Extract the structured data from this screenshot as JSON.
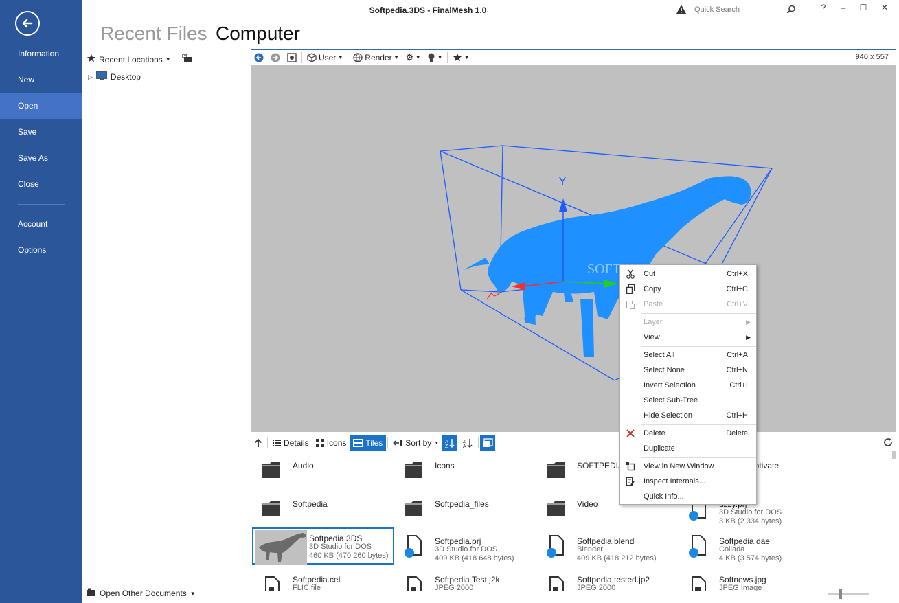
{
  "window": {
    "title": "Softpedia.3DS - FinalMesh 1.0",
    "search_placeholder": "Quick Search",
    "controls": [
      "?",
      "–",
      "☐",
      "✕"
    ]
  },
  "sidebar": {
    "items": [
      {
        "label": "Information"
      },
      {
        "label": "New"
      },
      {
        "label": "Open",
        "active": true
      },
      {
        "label": "Save"
      },
      {
        "label": "Save As"
      },
      {
        "label": "Close"
      }
    ],
    "bottom_items": [
      {
        "label": "Account"
      },
      {
        "label": "Options"
      }
    ]
  },
  "headings": {
    "recent": "Recent Files",
    "computer": "Computer"
  },
  "left_panel": {
    "recent_locations": "Recent Locations",
    "tree_desktop": "Desktop",
    "open_other": "Open Other Documents"
  },
  "viewer": {
    "user_label": "User",
    "render_label": "Render",
    "size_label": "940 x 557",
    "axis_label": "Y",
    "watermark": "SOFTPEDIA"
  },
  "files_toolbar": {
    "details": "Details",
    "icons": "Icons",
    "tiles": "Tiles",
    "sort_by": "Sort by"
  },
  "files": [
    {
      "name": "Audio",
      "kind": "folder"
    },
    {
      "name": "Icons",
      "kind": "folder"
    },
    {
      "name": "SOFTPEDIA 1",
      "kind": "folder"
    },
    {
      "name": "aptivate",
      "kind": "folder"
    },
    {
      "name": "Softpedia",
      "kind": "folder"
    },
    {
      "name": "Softpedia_files",
      "kind": "folder"
    },
    {
      "name": "Video",
      "kind": "folder"
    },
    {
      "name": "uzzy.prj",
      "type": "3D Studio for DOS",
      "size": "3 KB (2 334 bytes)",
      "kind": "file"
    },
    {
      "name": "Softpedia.3DS",
      "type": "3D Studio for DOS",
      "size": "460 KB (470 260 bytes)",
      "kind": "thumb"
    },
    {
      "name": "Softpedia.prj",
      "type": "3D Studio for DOS",
      "size": "409 KB (418 648 bytes)",
      "kind": "file"
    },
    {
      "name": "Softpedia.blend",
      "type": "Blender",
      "size": "409 KB (418 212 bytes)",
      "kind": "file"
    },
    {
      "name": "Softpedia.dae",
      "type": "Collada",
      "size": "4 KB (3 574 bytes)",
      "kind": "file"
    },
    {
      "name": "Softpedia.cel",
      "type": "FLIC file",
      "kind": "doc"
    },
    {
      "name": "Softpedia Test.j2k",
      "type": "JPEG 2000",
      "kind": "doc"
    },
    {
      "name": "Softpedia tested.jp2",
      "type": "JPEG 2000",
      "kind": "doc"
    },
    {
      "name": "Softnews.jpg",
      "type": "JPEG Image",
      "kind": "doc"
    }
  ],
  "context_menu": {
    "cut": {
      "label": "Cut",
      "shortcut": "Ctrl+X"
    },
    "copy": {
      "label": "Copy",
      "shortcut": "Ctrl+C"
    },
    "paste": {
      "label": "Paste",
      "shortcut": "Ctrl+V"
    },
    "layer": {
      "label": "Layer"
    },
    "view": {
      "label": "View"
    },
    "select_all": {
      "label": "Select All",
      "shortcut": "Ctrl+A"
    },
    "select_none": {
      "label": "Select None",
      "shortcut": "Ctrl+N"
    },
    "invert_selection": {
      "label": "Invert Selection",
      "shortcut": "Ctrl+I"
    },
    "select_subtree": {
      "label": "Select Sub-Tree"
    },
    "hide_selection": {
      "label": "Hide Selection",
      "shortcut": "Ctrl+H"
    },
    "delete": {
      "label": "Delete",
      "shortcut": "Delete"
    },
    "duplicate": {
      "label": "Duplicate"
    },
    "view_new_window": {
      "label": "View in New Window"
    },
    "inspect_internals": {
      "label": "Inspect Internals..."
    },
    "quick_info": {
      "label": "Quick Info..."
    }
  },
  "colors": {
    "sidebar": "#2b579a",
    "accent": "#1a73c8",
    "model": "#1e90ff",
    "viewport_bg": "#c0c0c0"
  }
}
